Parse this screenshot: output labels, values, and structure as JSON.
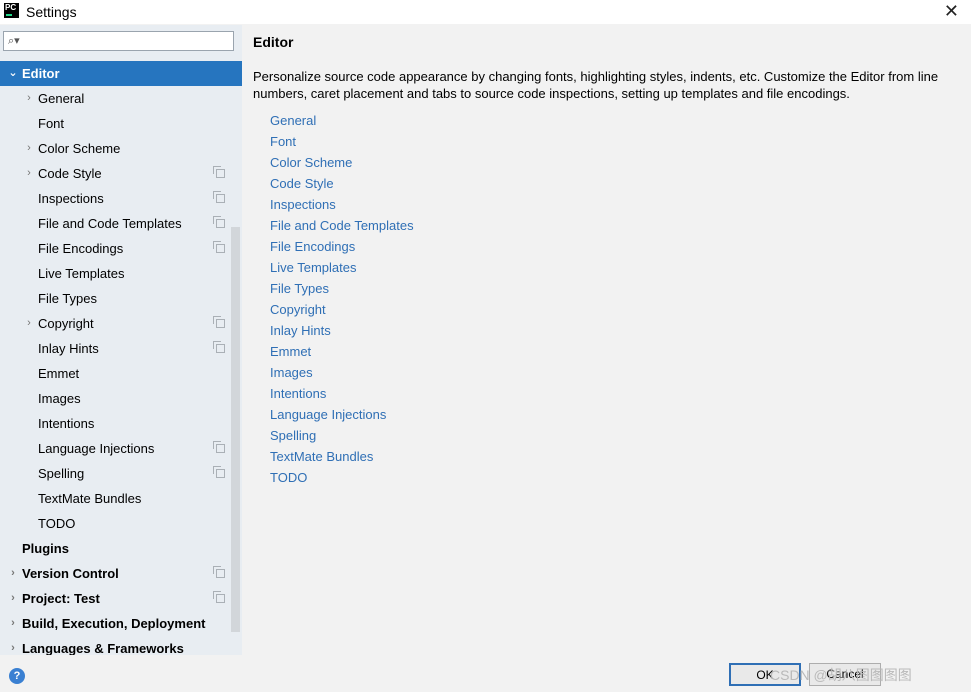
{
  "window": {
    "title": "Settings",
    "app_badge": "PC"
  },
  "search": {
    "placeholder": ""
  },
  "sidebar": {
    "items": [
      {
        "label": "Editor",
        "level": 0,
        "expanded": true,
        "selected": true,
        "bold": true,
        "has_chevron": true,
        "project_icon": false
      },
      {
        "label": "General",
        "level": 1,
        "has_chevron": true,
        "project_icon": false
      },
      {
        "label": "Font",
        "level": 1,
        "has_chevron": false,
        "project_icon": false
      },
      {
        "label": "Color Scheme",
        "level": 1,
        "has_chevron": true,
        "project_icon": false
      },
      {
        "label": "Code Style",
        "level": 1,
        "has_chevron": true,
        "project_icon": true
      },
      {
        "label": "Inspections",
        "level": 1,
        "has_chevron": false,
        "project_icon": true
      },
      {
        "label": "File and Code Templates",
        "level": 1,
        "has_chevron": false,
        "project_icon": true
      },
      {
        "label": "File Encodings",
        "level": 1,
        "has_chevron": false,
        "project_icon": true
      },
      {
        "label": "Live Templates",
        "level": 1,
        "has_chevron": false,
        "project_icon": false
      },
      {
        "label": "File Types",
        "level": 1,
        "has_chevron": false,
        "project_icon": false
      },
      {
        "label": "Copyright",
        "level": 1,
        "has_chevron": true,
        "project_icon": true
      },
      {
        "label": "Inlay Hints",
        "level": 1,
        "has_chevron": false,
        "project_icon": true
      },
      {
        "label": "Emmet",
        "level": 1,
        "has_chevron": false,
        "project_icon": false
      },
      {
        "label": "Images",
        "level": 1,
        "has_chevron": false,
        "project_icon": false
      },
      {
        "label": "Intentions",
        "level": 1,
        "has_chevron": false,
        "project_icon": false
      },
      {
        "label": "Language Injections",
        "level": 1,
        "has_chevron": false,
        "project_icon": true
      },
      {
        "label": "Spelling",
        "level": 1,
        "has_chevron": false,
        "project_icon": true
      },
      {
        "label": "TextMate Bundles",
        "level": 1,
        "has_chevron": false,
        "project_icon": false
      },
      {
        "label": "TODO",
        "level": 1,
        "has_chevron": false,
        "project_icon": false
      },
      {
        "label": "Plugins",
        "level": 0,
        "bold": true,
        "has_chevron": false,
        "project_icon": false
      },
      {
        "label": "Version Control",
        "level": 0,
        "bold": true,
        "has_chevron": true,
        "project_icon": true
      },
      {
        "label": "Project: Test",
        "level": 0,
        "bold": true,
        "has_chevron": true,
        "project_icon": true
      },
      {
        "label": "Build, Execution, Deployment",
        "level": 0,
        "bold": true,
        "has_chevron": true,
        "project_icon": false
      },
      {
        "label": "Languages & Frameworks",
        "level": 0,
        "bold": true,
        "has_chevron": true,
        "project_icon": false
      }
    ]
  },
  "main": {
    "title": "Editor",
    "description": "Personalize source code appearance by changing fonts, highlighting styles, indents, etc. Customize the Editor from line numbers, caret placement and tabs to source code inspections, setting up templates and file encodings.",
    "links": [
      "General",
      "Font",
      "Color Scheme",
      "Code Style",
      "Inspections",
      "File and Code Templates",
      "File Encodings",
      "Live Templates",
      "File Types",
      "Copyright",
      "Inlay Hints",
      "Emmet",
      "Images",
      "Intentions",
      "Language Injections",
      "Spelling",
      "TextMate Bundles",
      "TODO"
    ]
  },
  "footer": {
    "help_label": "?",
    "ok_label": "OK",
    "cancel_label": "Cancel",
    "watermark": "CSDN @胡八图图图图"
  },
  "colors": {
    "selection": "#2675bf",
    "link": "#2f6fb5",
    "sidebar_bg": "#e8edf2",
    "accent": "#21d789"
  },
  "icons": {
    "search": "search-icon",
    "close": "close-icon",
    "chevron": "chevron-icon",
    "project_scope": "project-scope-icon",
    "help": "help-icon"
  }
}
